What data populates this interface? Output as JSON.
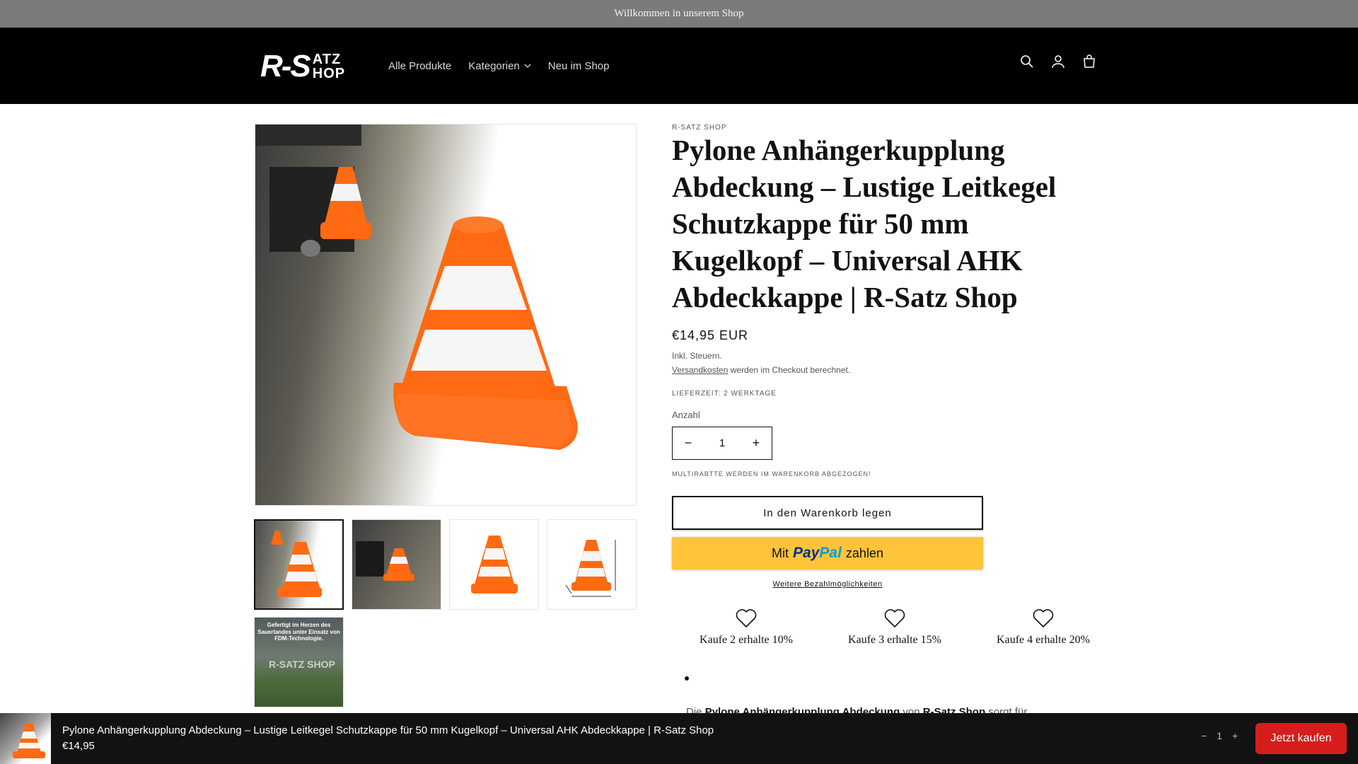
{
  "announcement": "Willkommen in unserem Shop",
  "header": {
    "logo_main": "R-S",
    "logo_top": "ATZ",
    "logo_bottom": "HOP",
    "nav": [
      "Alle Produkte",
      "Kategorien",
      "Neu im Shop"
    ],
    "icons": [
      "search-icon",
      "account-icon",
      "cart-icon"
    ]
  },
  "product": {
    "vendor": "R-SATZ SHOP",
    "title": "Pylone Anhängerkupplung Abdeckung – Lustige Leitkegel Schutzkappe für 50 mm Kugelkopf – Universal AHK Abdeckkappe | R-Satz Shop",
    "price": "€14,95 EUR",
    "tax_note": "Inkl. Steuern.",
    "shipping_link": "Versandkosten",
    "shipping_rest": " werden im Checkout berechnet.",
    "delivery": "LIEFERZEIT: 2 WERKTAGE",
    "quantity_label": "Anzahl",
    "quantity": "1",
    "multi_discount_note": "MULTIRABTTE WERDEN IM WARENKORB ABGEZOGEN!",
    "add_to_cart": "In den Warenkorb legen",
    "paypal_prefix": "Mit",
    "paypal_brand_1": "Pay",
    "paypal_brand_2": "Pal",
    "paypal_suffix": "zahlen",
    "more_payment": "Weitere Bezahlmöglichkeiten",
    "discounts": [
      "Kaufe 2 erhalte 10%",
      "Kaufe 3 erhalte 15%",
      "Kaufe 4 erhalte 20%"
    ],
    "description_start": "Die ",
    "description_bold_1": "Pylone Anhängerkupplung Abdeckung",
    "description_mid": " von ",
    "description_bold_2": "R-Satz Shop",
    "description_end": " sorgt für"
  },
  "gallery": {
    "thumb_text": "Gefertigt im Herzen des Sauerlandes unter Einsatz von FDM-Technologie.",
    "thumb_logo": "R-SATZ SHOP"
  },
  "sticky": {
    "title": "Pylone Anhängerkupplung Abdeckung – Lustige Leitkegel Schutzkappe für 50 mm Kugelkopf – Universal AHK Abdeckkappe | R-Satz Shop",
    "price": "€14,95",
    "quantity": "1",
    "buy_now": "Jetzt kaufen"
  },
  "colors": {
    "announcement_bg": "#7b7b7b",
    "header_bg": "#000000",
    "paypal": "#ffc439",
    "buy_now": "#d71c1c",
    "cone_orange": "#ff6a13"
  }
}
